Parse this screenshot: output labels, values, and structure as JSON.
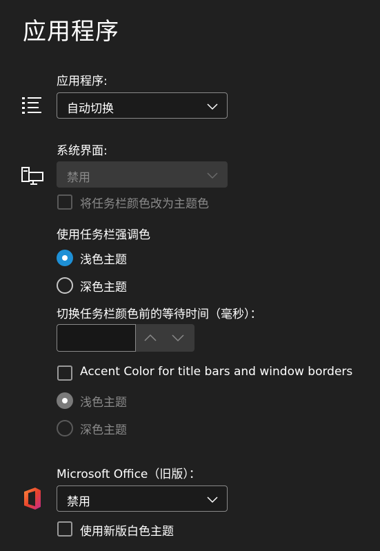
{
  "page": {
    "title": "应用程序"
  },
  "apps": {
    "label": "应用程序:",
    "icon": "list-icon",
    "dropdown_value": "自动切换"
  },
  "system": {
    "label": "系统界面:",
    "icon": "desktop-icon",
    "dropdown_value": "禁用",
    "taskbar_checkbox_label": "将任务栏颜色改为主题色"
  },
  "taskbar_accent": {
    "heading": "使用任务栏强调色",
    "options": [
      {
        "label": "浅色主题",
        "checked": true
      },
      {
        "label": "深色主题",
        "checked": false
      }
    ]
  },
  "delay": {
    "label": "切换任务栏颜色前的等待时间（毫秒）："
  },
  "accent_titlebar": {
    "checkbox_label": "Accent Color for title bars and window borders",
    "options": [
      {
        "label": "浅色主题",
        "checked": true
      },
      {
        "label": "深色主题",
        "checked": false
      }
    ]
  },
  "office": {
    "label": "Microsoft Office（旧版）：",
    "icon": "office-icon",
    "dropdown_value": "禁用",
    "checkbox_label": "使用新版白色主题"
  },
  "colors": {
    "background": "#202020",
    "accent": "#1e90d6",
    "disabled_fill": "#3a3a3a"
  }
}
